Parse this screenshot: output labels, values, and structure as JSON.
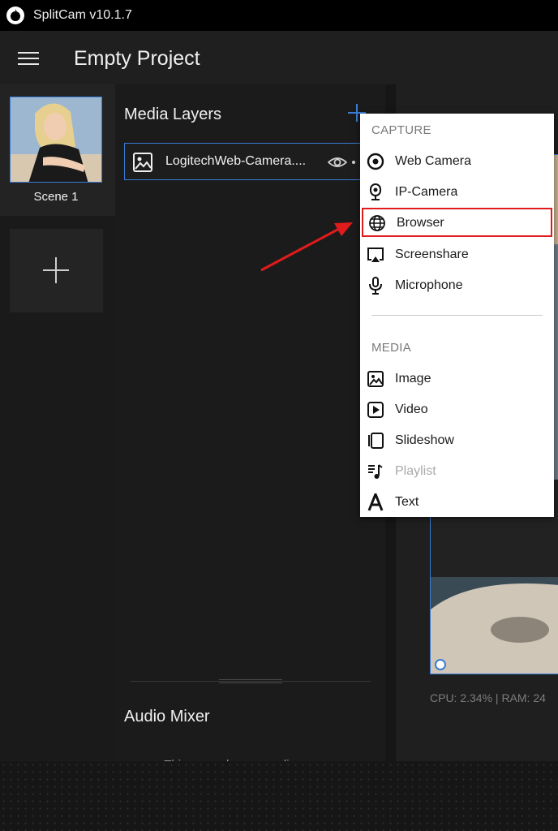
{
  "window": {
    "title": "SplitCam v10.1.7"
  },
  "header": {
    "project_title": "Empty Project"
  },
  "scenes": {
    "items": [
      {
        "label": "Scene 1"
      }
    ]
  },
  "media_layers": {
    "title": "Media Layers",
    "items": [
      {
        "name": "LogitechWeb-Camera...."
      }
    ]
  },
  "audio_mixer": {
    "title": "Audio Mixer",
    "empty_text": "This scene has no audio sources."
  },
  "preview": {
    "stats": "CPU: 2.34% | RAM: 24"
  },
  "add_menu": {
    "capture_label": "CAPTURE",
    "capture_items": [
      {
        "label": "Web Camera",
        "icon": "webcam-icon"
      },
      {
        "label": "IP-Camera",
        "icon": "ip-camera-icon"
      },
      {
        "label": "Browser",
        "icon": "globe-icon"
      },
      {
        "label": "Screenshare",
        "icon": "screenshare-icon"
      },
      {
        "label": "Microphone",
        "icon": "microphone-icon"
      }
    ],
    "media_label": "MEDIA",
    "media_items": [
      {
        "label": "Image",
        "icon": "image-icon"
      },
      {
        "label": "Video",
        "icon": "video-icon"
      },
      {
        "label": "Slideshow",
        "icon": "slideshow-icon"
      },
      {
        "label": "Playlist",
        "icon": "playlist-icon",
        "disabled": true
      },
      {
        "label": "Text",
        "icon": "text-icon"
      }
    ]
  },
  "colors": {
    "accent": "#3a7bd5",
    "highlight": "#e01b1b"
  }
}
